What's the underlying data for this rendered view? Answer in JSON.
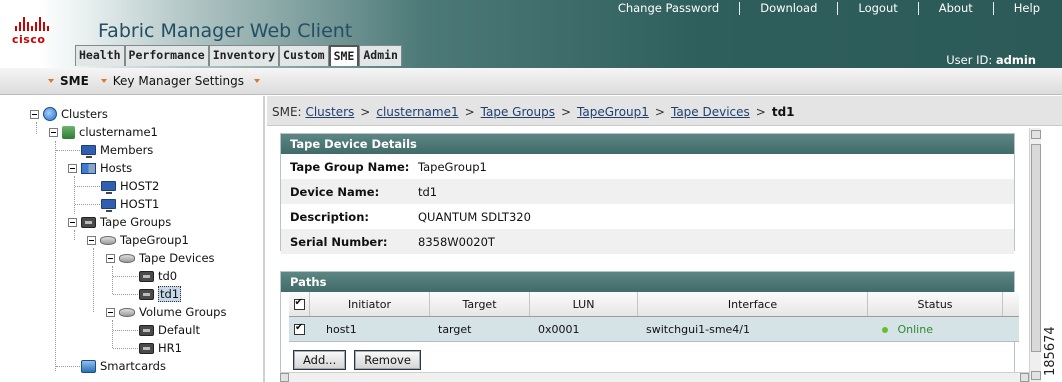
{
  "header": {
    "brand": "cisco",
    "app_title": "Fabric Manager Web Client",
    "top_links": [
      "Change Password",
      "Download",
      "Logout",
      "About",
      "Help"
    ],
    "user_label": "User ID:",
    "user_name": "admin",
    "tabs": [
      "Health",
      "Performance",
      "Inventory",
      "Custom",
      "SME",
      "Admin"
    ],
    "active_tab": "SME"
  },
  "subnav": {
    "items": [
      "SME",
      "Key Manager Settings"
    ],
    "caret_color": "#e0742a"
  },
  "tree": {
    "nodes": [
      {
        "label": "Clusters",
        "icon": "globe-icon"
      },
      {
        "label": "clustername1",
        "icon": "cluster-icon"
      },
      {
        "label": "Members",
        "icon": "monitor-icon"
      },
      {
        "label": "Hosts",
        "icon": "hosts-icon"
      },
      {
        "label": "HOST2",
        "icon": "monitor-icon"
      },
      {
        "label": "HOST1",
        "icon": "monitor-icon"
      },
      {
        "label": "Tape Groups",
        "icon": "tape-icon"
      },
      {
        "label": "TapeGroup1",
        "icon": "disk-icon"
      },
      {
        "label": "Tape Devices",
        "icon": "disk-icon"
      },
      {
        "label": "td0",
        "icon": "tape-icon"
      },
      {
        "label": "td1",
        "icon": "tape-icon",
        "selected": true
      },
      {
        "label": "Volume Groups",
        "icon": "disk-icon"
      },
      {
        "label": "Default",
        "icon": "tape-icon"
      },
      {
        "label": "HR1",
        "icon": "tape-icon"
      },
      {
        "label": "Smartcards",
        "icon": "smartcard-icon"
      }
    ]
  },
  "breadcrumb": {
    "prefix": "SME:",
    "links": [
      "Clusters",
      "clustername1",
      "Tape Groups",
      "TapeGroup1",
      "Tape Devices"
    ],
    "current": "td1",
    "separator": ">"
  },
  "details": {
    "title": "Tape Device Details",
    "rows": [
      {
        "label": "Tape Group Name:",
        "value": "TapeGroup1"
      },
      {
        "label": "Device Name:",
        "value": "td1"
      },
      {
        "label": "Description:",
        "value": "QUANTUM SDLT320"
      },
      {
        "label": "Serial Number:",
        "value": "8358W0020T"
      }
    ]
  },
  "paths": {
    "title": "Paths",
    "columns": [
      "Initiator",
      "Target",
      "LUN",
      "Interface",
      "Status"
    ],
    "rows": [
      {
        "checked": true,
        "initiator": "host1",
        "target": "target",
        "lun": "0x0001",
        "interface": "switchgui1-sme4/1",
        "status": "Online"
      }
    ],
    "status_color": "#5fbf2f",
    "add_label": "Add...",
    "remove_label": "Remove"
  },
  "figure_id": "185674",
  "colors": {
    "header_dark": "#2b5a58",
    "panel_head": "#4a7573",
    "accent_red": "#cc0000"
  }
}
